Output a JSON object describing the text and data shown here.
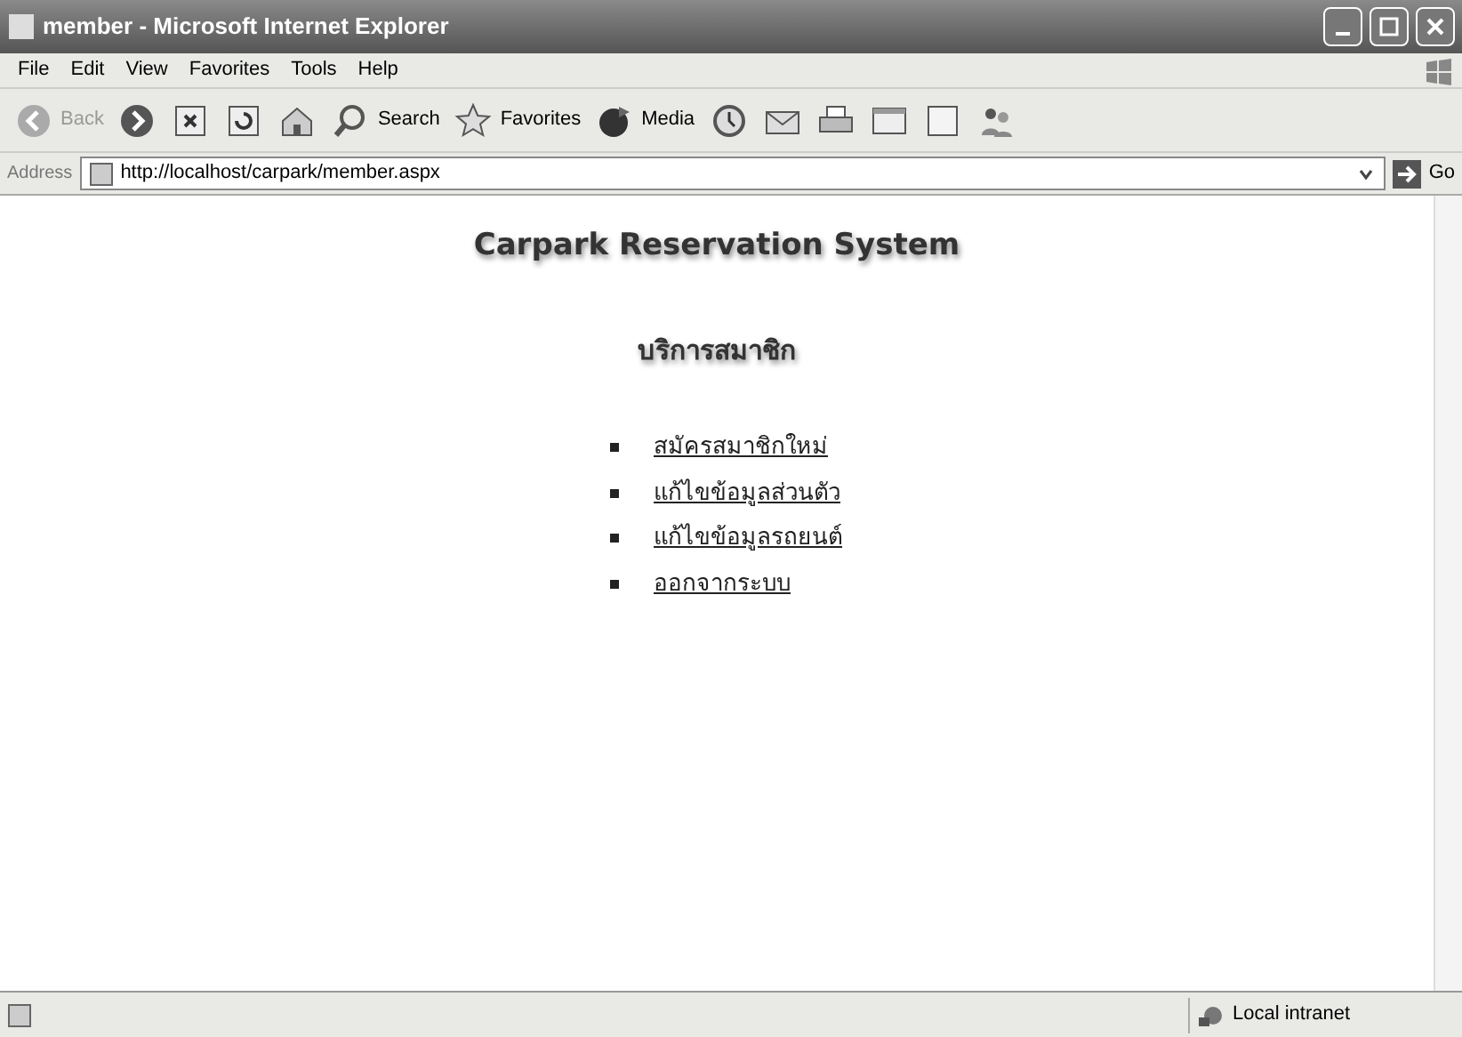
{
  "window": {
    "title": "member - Microsoft Internet Explorer"
  },
  "menu": [
    "File",
    "Edit",
    "View",
    "Favorites",
    "Tools",
    "Help"
  ],
  "toolbar": [
    {
      "kind": "back",
      "label": "Back",
      "disabled": true
    },
    {
      "kind": "forward",
      "disabled": false
    },
    {
      "kind": "stop",
      "disabled": false
    },
    {
      "kind": "refresh",
      "disabled": false
    },
    {
      "kind": "home",
      "disabled": false
    },
    {
      "kind": "search",
      "label": "Search",
      "disabled": false
    },
    {
      "kind": "favorites",
      "label": "Favorites",
      "disabled": false
    },
    {
      "kind": "media",
      "label": "Media",
      "disabled": false
    },
    {
      "kind": "history",
      "disabled": false
    },
    {
      "kind": "mail",
      "disabled": false
    },
    {
      "kind": "print",
      "disabled": false
    },
    {
      "kind": "edit",
      "disabled": false
    },
    {
      "kind": "discuss",
      "disabled": false
    },
    {
      "kind": "messenger",
      "disabled": false
    }
  ],
  "address_bar": {
    "label": "Address",
    "url": "http://localhost/carpark/member.aspx",
    "go": "Go"
  },
  "page": {
    "title": "Carpark Reservation System",
    "subtitle": "บริการสมาชิก",
    "links": [
      "สมัครสมาชิกใหม่",
      "แก้ไขข้อมูลส่วนตัว",
      "แก้ไขข้อมูลรถยนต์",
      "ออกจากระบบ"
    ]
  },
  "status_bar": {
    "zone": "Local intranet"
  }
}
